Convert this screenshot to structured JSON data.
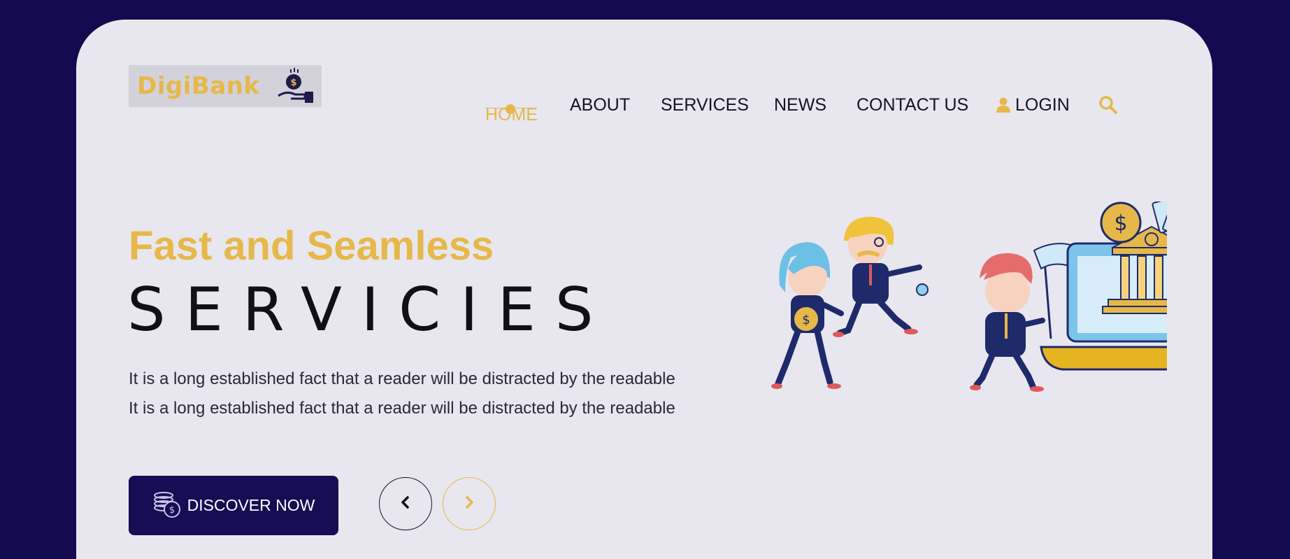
{
  "logo": {
    "text": "DigiBank"
  },
  "nav": {
    "items": [
      {
        "label": "HOME",
        "active": true
      },
      {
        "label": "ABOUT"
      },
      {
        "label": "SERVICES"
      },
      {
        "label": "NEWS"
      },
      {
        "label": "CONTACT US"
      },
      {
        "label": "LOGIN"
      }
    ]
  },
  "hero": {
    "kicker": "Fast and Seamless",
    "title": "SERVICIES",
    "lines": [
      "It is a long established fact that a reader will be distracted by the readable",
      "It is a long established fact that a reader will be distracted by the readable"
    ],
    "cta_label": "DISCOVER NOW"
  },
  "colors": {
    "background": "#140a4f",
    "card": "#e8e7ef",
    "accent": "#e6b84a",
    "button": "#160d54"
  },
  "icons": [
    "hand-coin-icon",
    "user-icon",
    "search-icon",
    "coins-icon",
    "chevron-left-icon",
    "chevron-right-icon"
  ]
}
